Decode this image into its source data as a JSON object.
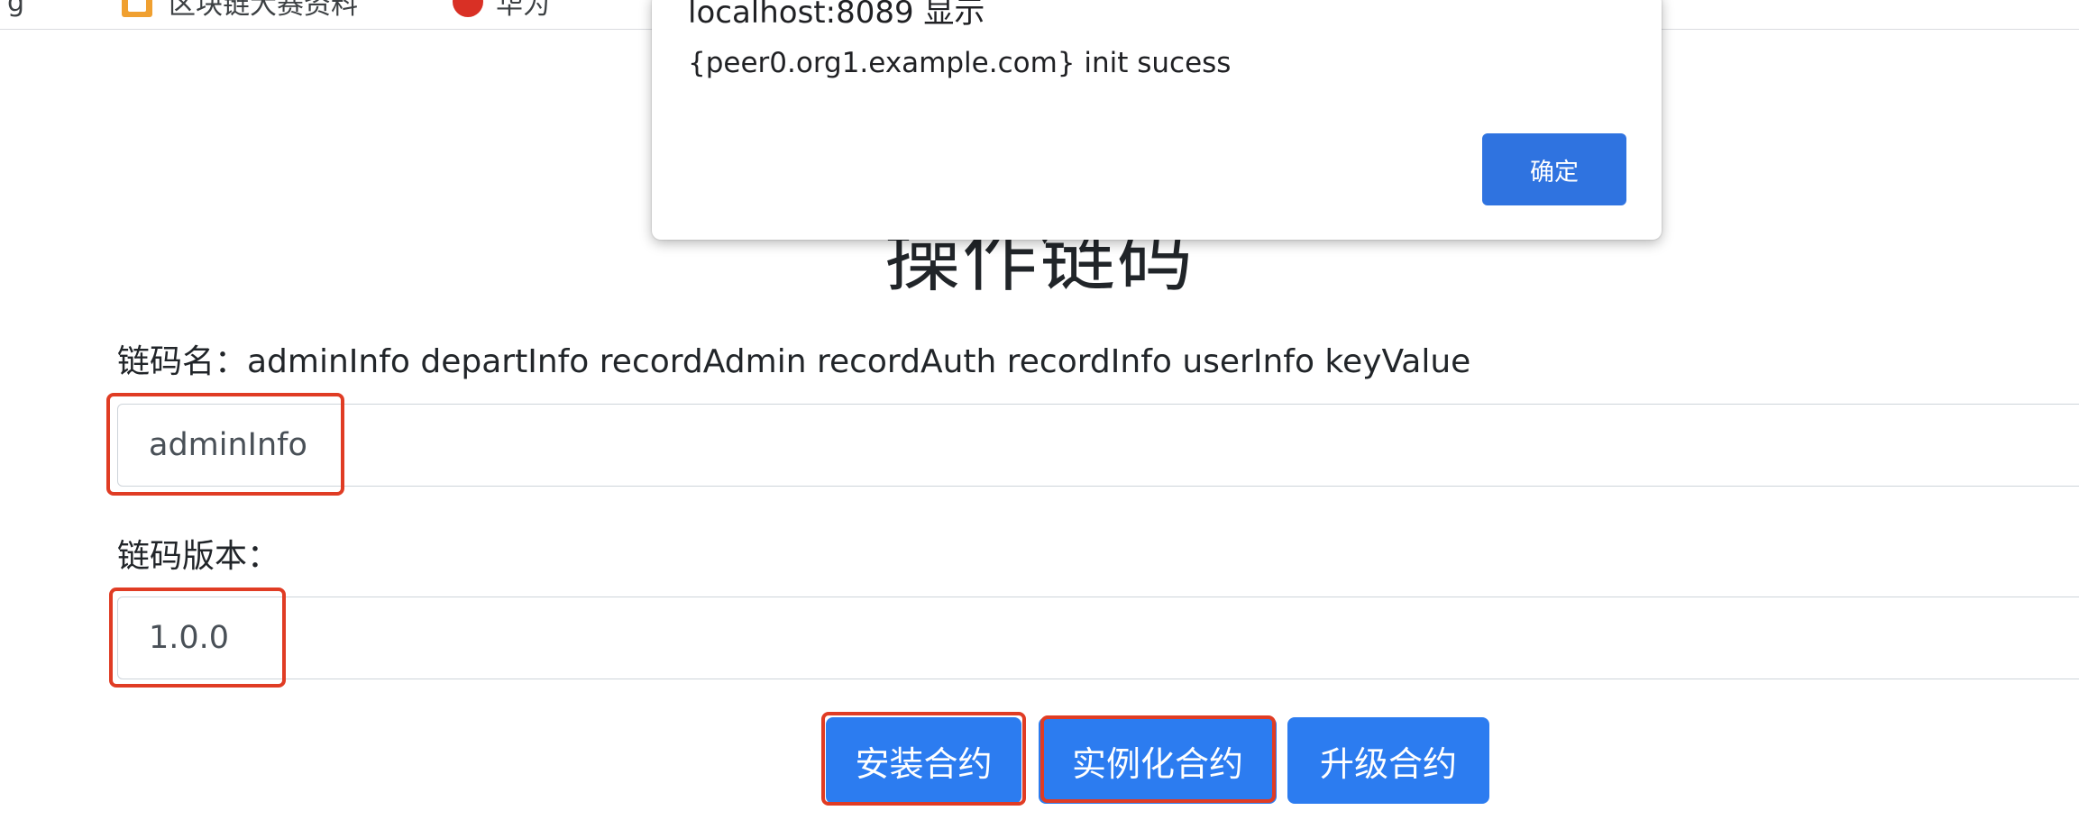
{
  "bookmarks": {
    "first_label": "g",
    "second_label": "区块链大赛资料",
    "third_label": "华为"
  },
  "alert": {
    "title": "localhost:8089 显示",
    "message": "{peer0.org1.example.com} init sucess",
    "ok_label": "确定"
  },
  "page": {
    "title": "操作链码"
  },
  "form": {
    "chaincode_name_label": "链码名：adminInfo departInfo recordAdmin recordAuth recordInfo userInfo keyValue",
    "chaincode_name_value": "adminInfo",
    "chaincode_version_label": "链码版本：",
    "chaincode_version_value": "1.0.0"
  },
  "actions": {
    "install_label": "安装合约",
    "instantiate_label": "实例化合约",
    "upgrade_label": "升级合约"
  },
  "colors": {
    "primary_button": "#2c7cf0",
    "highlight_border": "#e03c24",
    "alert_button": "#2f73e0"
  },
  "icons": [
    "bookmark-doc-icon",
    "bookmark-dot-icon"
  ]
}
